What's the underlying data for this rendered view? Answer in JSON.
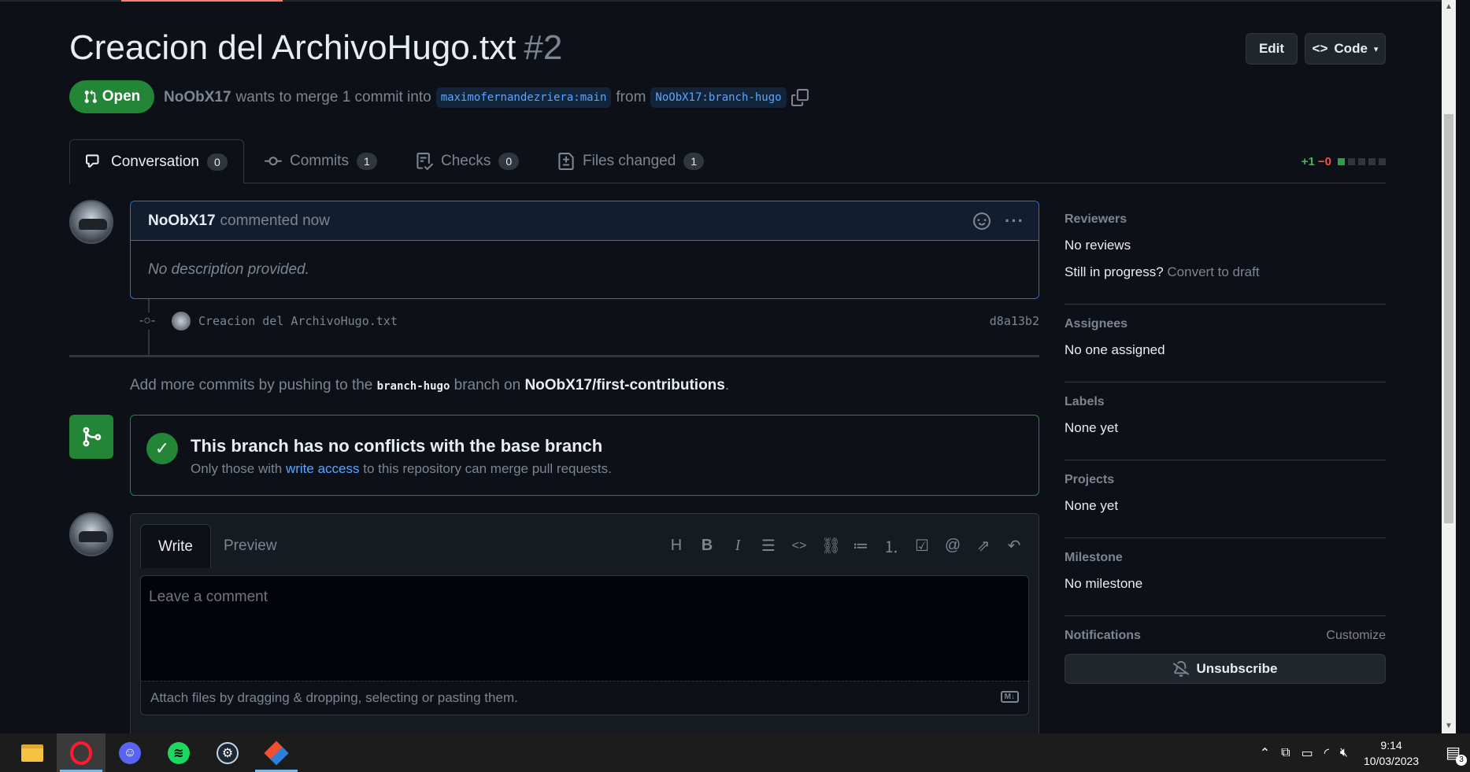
{
  "pr": {
    "title": "Creacion del ArchivoHugo.txt",
    "number": "#2",
    "state": "Open",
    "author": "NoObX17",
    "merge_text": "wants to merge 1 commit into",
    "base_branch": "maximofernandezriera:main",
    "from_text": "from",
    "head_branch": "NoObX17:branch-hugo"
  },
  "header_buttons": {
    "edit": "Edit",
    "code": "Code"
  },
  "tabs": [
    {
      "label": "Conversation",
      "count": "0"
    },
    {
      "label": "Commits",
      "count": "1"
    },
    {
      "label": "Checks",
      "count": "0"
    },
    {
      "label": "Files changed",
      "count": "1"
    }
  ],
  "diffstat": {
    "additions": "+1",
    "deletions": "−0"
  },
  "comment": {
    "author": "NoObX17",
    "action": "commented now",
    "body": "No description provided."
  },
  "commit": {
    "message": "Creacion del ArchivoHugo.txt",
    "sha": "d8a13b2"
  },
  "push_hint": {
    "prefix": "Add more commits by pushing to the",
    "branch": "branch-hugo",
    "middle": "branch on",
    "repo": "NoObX17/first-contributions",
    "suffix": "."
  },
  "merge_status": {
    "title": "This branch has no conflicts with the base branch",
    "sub_prefix": "Only those with",
    "sub_link": "write access",
    "sub_suffix": "to this repository can merge pull requests."
  },
  "editor": {
    "write_tab": "Write",
    "preview_tab": "Preview",
    "placeholder": "Leave a comment",
    "attach_text": "Attach files by dragging & dropping, selecting or pasting them.",
    "md_badge": "M↓"
  },
  "sidebar": {
    "reviewers": {
      "heading": "Reviewers",
      "value": "No reviews",
      "progress_q": "Still in progress?",
      "draft_link": "Convert to draft"
    },
    "assignees": {
      "heading": "Assignees",
      "value": "No one assigned"
    },
    "labels": {
      "heading": "Labels",
      "value": "None yet"
    },
    "projects": {
      "heading": "Projects",
      "value": "None yet"
    },
    "milestone": {
      "heading": "Milestone",
      "value": "No milestone"
    },
    "notifications": {
      "heading": "Notifications",
      "customize": "Customize",
      "unsubscribe": "Unsubscribe"
    }
  },
  "taskbar": {
    "time": "9:14",
    "date": "10/03/2023",
    "notification_count": "3"
  }
}
